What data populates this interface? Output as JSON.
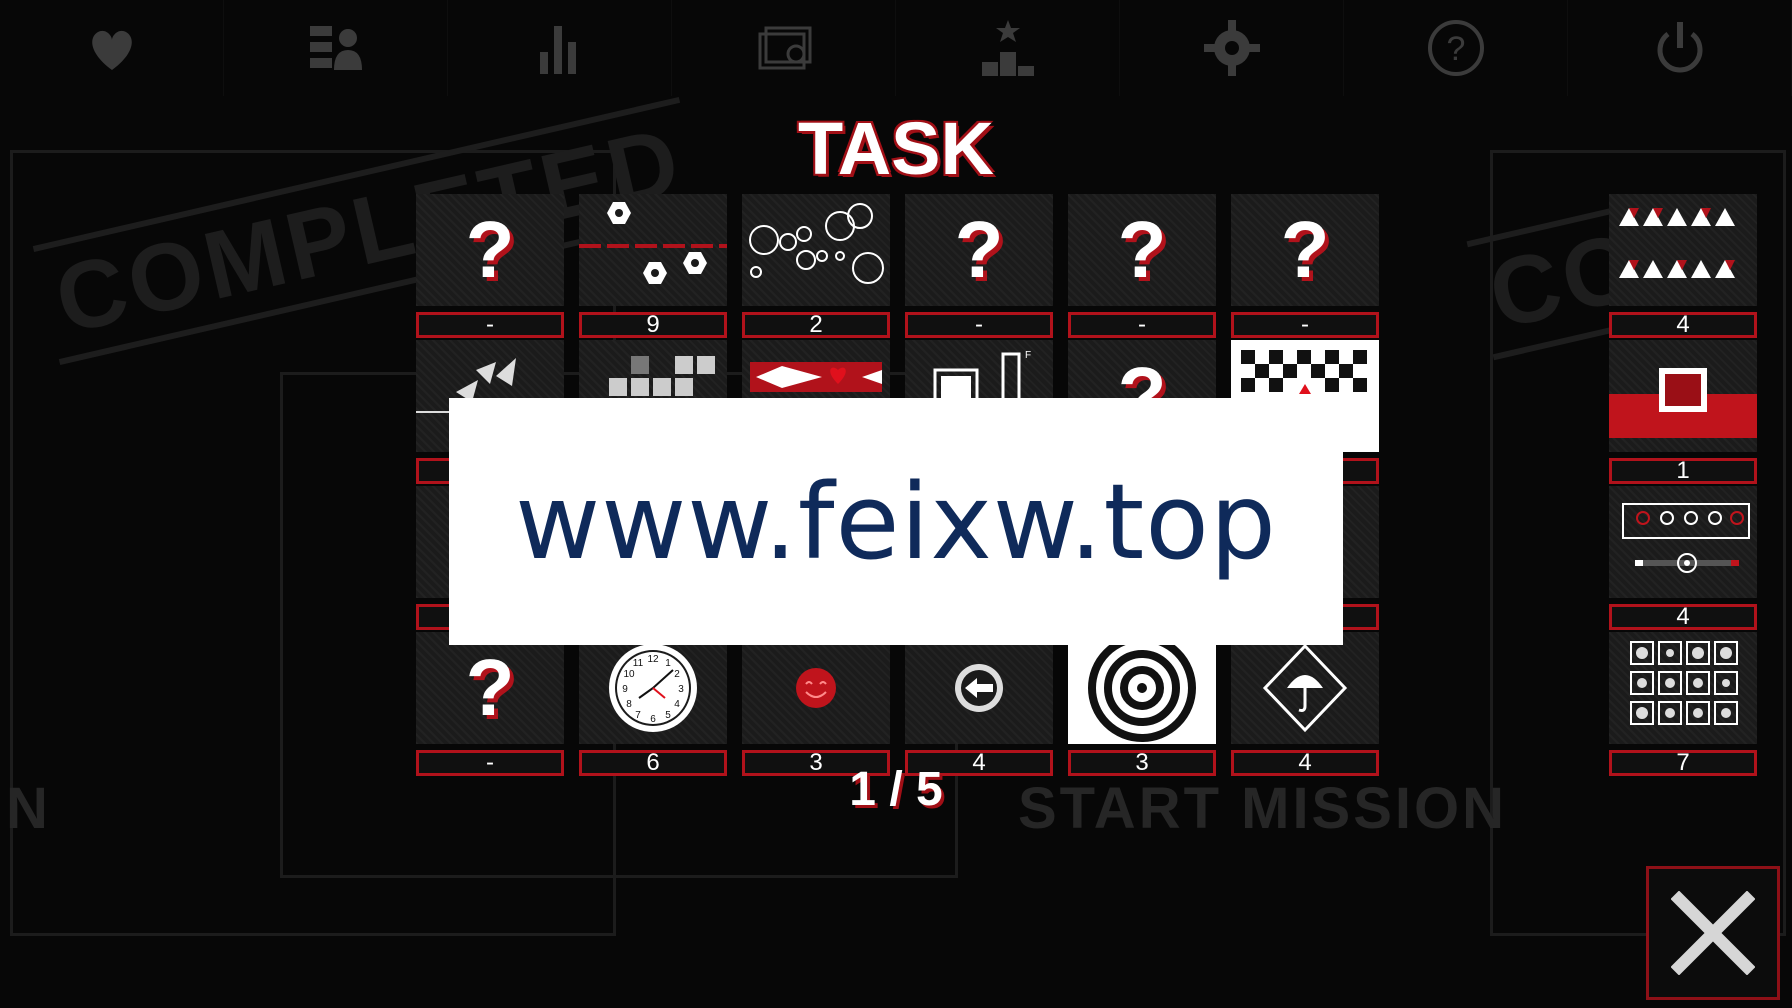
{
  "nav": [
    {
      "name": "heart-hand-icon"
    },
    {
      "name": "profile-icon"
    },
    {
      "name": "stats-icon"
    },
    {
      "name": "cards-icon"
    },
    {
      "name": "leaderboard-icon"
    },
    {
      "name": "gear-icon"
    },
    {
      "name": "help-icon"
    },
    {
      "name": "power-icon"
    }
  ],
  "background": {
    "stamp_left": "COMPLETED",
    "stamp_right": "CO",
    "start_mission": "START MISSION",
    "left_letter": "N"
  },
  "title": "TASK",
  "tasks": [
    {
      "icon": "unknown-icon",
      "count": "-"
    },
    {
      "icon": "hexagon-nuts-icon",
      "count": "9"
    },
    {
      "icon": "circles-icon",
      "count": "2"
    },
    {
      "icon": "unknown-icon",
      "count": "-"
    },
    {
      "icon": "unknown-icon",
      "count": "-"
    },
    {
      "icon": "unknown-icon",
      "count": "-"
    },
    {
      "icon": "birds-icon",
      "count": ""
    },
    {
      "icon": "blocks-icon",
      "count": ""
    },
    {
      "icon": "diamond-heart-icon",
      "count": ""
    },
    {
      "icon": "bars-icon",
      "count": ""
    },
    {
      "icon": "unknown-icon",
      "count": ""
    },
    {
      "icon": "checker-icon",
      "count": ""
    },
    {
      "icon": "hidden-icon",
      "count": ""
    },
    {
      "icon": "hidden-icon",
      "count": ""
    },
    {
      "icon": "hidden-icon",
      "count": ""
    },
    {
      "icon": "hidden-icon",
      "count": ""
    },
    {
      "icon": "hidden-icon",
      "count": ""
    },
    {
      "icon": "hidden-icon",
      "count": ""
    },
    {
      "icon": "unknown-icon",
      "count": "-"
    },
    {
      "icon": "clock-icon",
      "count": "6"
    },
    {
      "icon": "smiley-icon",
      "count": "3"
    },
    {
      "icon": "arrow-left-circle-icon",
      "count": "4"
    },
    {
      "icon": "spiral-icon",
      "count": "3"
    },
    {
      "icon": "umbrella-icon",
      "count": "4"
    }
  ],
  "side_tasks": [
    {
      "icon": "triangles-icon",
      "count": "4"
    },
    {
      "icon": "red-square-icon",
      "count": "1"
    },
    {
      "icon": "slider-icon",
      "count": "4"
    },
    {
      "icon": "weather-grid-icon",
      "count": "7"
    }
  ],
  "pager": "1 / 5",
  "ad_text": "www.feixw.top",
  "close_icon": "close-icon"
}
